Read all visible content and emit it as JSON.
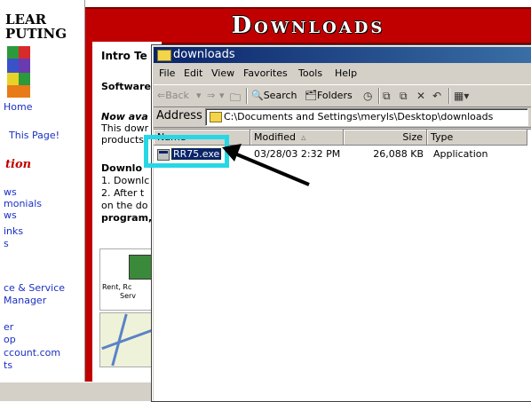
{
  "background_page": {
    "logo_lines": [
      "LEAR",
      "PUTING"
    ],
    "banner_title": "Downloads",
    "nav_links": [
      "Home",
      "This Page!",
      "ws",
      "monials",
      "ws",
      "inks",
      "s",
      "ce & Service",
      "Manager",
      "er",
      "op",
      "ccount.com",
      "ts"
    ],
    "nav_section": "tion",
    "content_lines": [
      "Intro Te",
      "Software",
      "Now ava",
      "This dowr",
      "products",
      "Downlo",
      "1. Downlc",
      "2. After t",
      "on the do",
      "program,"
    ],
    "product_label": "Rent, Rc",
    "product_label2": "Serv"
  },
  "window": {
    "title": "downloads",
    "menu": [
      "File",
      "Edit",
      "View",
      "Favorites",
      "Tools",
      "Help"
    ],
    "toolbar": {
      "back": "Back",
      "search": "Search",
      "folders": "Folders"
    },
    "address_label": "Address",
    "address_path": "C:\\Documents and Settings\\meryls\\Desktop\\downloads",
    "columns": {
      "name": "Name",
      "modified": "Modified",
      "size": "Size",
      "type": "Type"
    },
    "files": [
      {
        "name": "RR75.exe",
        "modified": "03/28/03 2:32 PM",
        "size": "26,088 KB",
        "type": "Application"
      }
    ]
  },
  "colors": {
    "banner_red": "#c00000",
    "titlebar_blue": "#0a246a",
    "highlight_cyan": "#26d7e6",
    "link_blue": "#1a2fc4"
  },
  "icons": [
    "puzzle-logo-icon",
    "folder-icon",
    "back-arrow-icon",
    "forward-arrow-icon",
    "up-folder-icon",
    "search-icon",
    "folders-icon",
    "history-icon",
    "move-to-icon",
    "copy-to-icon",
    "delete-icon",
    "undo-icon",
    "views-icon",
    "application-file-icon",
    "pointer-arrow-icon"
  ]
}
